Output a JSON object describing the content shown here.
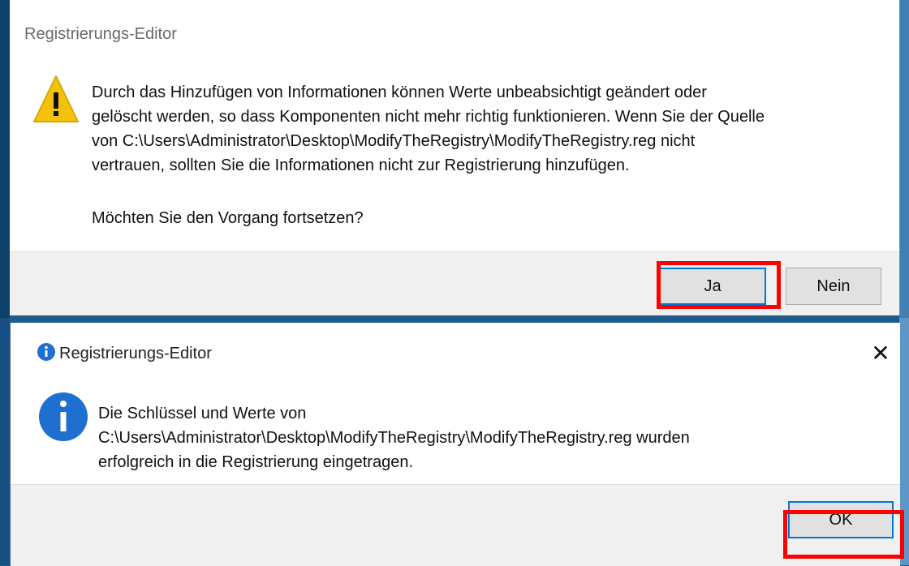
{
  "dialog1": {
    "title": "Registrierungs-Editor",
    "message_lines": [
      "Durch das Hinzufügen von Informationen können Werte unbeabsichtigt geändert oder",
      "gelöscht werden, so dass Komponenten nicht mehr richtig funktionieren. Wenn Sie der Quelle",
      "von C:\\Users\\Administrator\\Desktop\\ModifyTheRegistry\\ModifyTheRegistry.reg nicht",
      "vertrauen, sollten Sie die Informationen nicht zur Registrierung hinzufügen."
    ],
    "question": "Möchten Sie den Vorgang fortsetzen?",
    "buttons": {
      "yes": "Ja",
      "no": "Nein"
    },
    "icon": "warning-icon"
  },
  "dialog2": {
    "title": "Registrierungs-Editor",
    "message_lines": [
      "Die Schlüssel und Werte von",
      "C:\\Users\\Administrator\\Desktop\\ModifyTheRegistry\\ModifyTheRegistry.reg wurden",
      "erfolgreich in die Registrierung eingetragen."
    ],
    "buttons": {
      "ok": "OK"
    },
    "icon": "info-icon",
    "close_icon": "close-icon"
  },
  "colors": {
    "highlight": "#ff0000",
    "warning": "#f4c20d",
    "info": "#1f6fd1",
    "focus_border": "#0078d7"
  }
}
